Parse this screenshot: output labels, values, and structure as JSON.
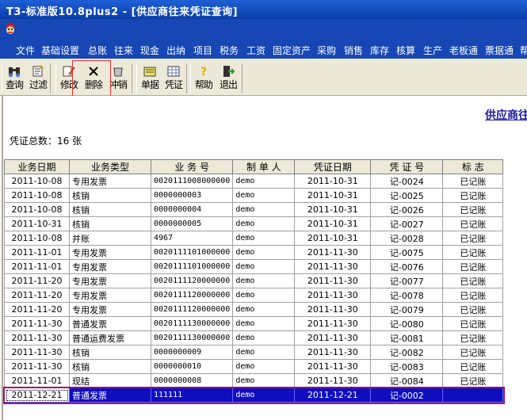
{
  "window": {
    "title": "T3-标准版10.8plus2 - [供应商往来凭证查询]"
  },
  "menu": [
    "文件",
    "基础设置",
    "总账",
    "往来",
    "现金",
    "出纳",
    "项目",
    "税务",
    "工资",
    "固定资产",
    "采购",
    "销售",
    "库存",
    "核算",
    "生产",
    "老板通",
    "票据通",
    "帮"
  ],
  "toolbar": {
    "buttons": [
      {
        "label": "查询",
        "icon": "binoculars-icon"
      },
      {
        "label": "过滤",
        "icon": "filter-icon"
      },
      {
        "label": "修改",
        "icon": "edit-icon"
      },
      {
        "label": "删除",
        "icon": "delete-icon"
      },
      {
        "label": "冲销",
        "icon": "reverse-icon"
      },
      {
        "label": "单据",
        "icon": "document-icon"
      },
      {
        "label": "凭证",
        "icon": "voucher-icon"
      },
      {
        "label": "帮助",
        "icon": "help-icon"
      },
      {
        "label": "退出",
        "icon": "exit-icon"
      }
    ]
  },
  "report": {
    "title": "供应商往",
    "count_label": "凭证总数：16 张"
  },
  "table": {
    "columns": [
      "业务日期",
      "业务类型",
      "业 务 号",
      "制 单 人",
      "凭证日期",
      "凭 证 号",
      "标    志"
    ],
    "rows": [
      [
        "2011-10-08",
        "专用发票",
        "0020111008000000",
        "demo",
        "2011-10-31",
        "记-0024",
        "已记账"
      ],
      [
        "2011-10-08",
        "核销",
        "0000000003",
        "demo",
        "2011-10-31",
        "记-0025",
        "已记账"
      ],
      [
        "2011-10-08",
        "核销",
        "0000000004",
        "demo",
        "2011-10-31",
        "记-0026",
        "已记账"
      ],
      [
        "2011-10-31",
        "核销",
        "0000000005",
        "demo",
        "2011-10-31",
        "记-0027",
        "已记账"
      ],
      [
        "2011-10-08",
        "并账",
        "4967",
        "demo",
        "2011-10-31",
        "记-0028",
        "已记账"
      ],
      [
        "2011-11-01",
        "专用发票",
        "0020111101000000",
        "demo",
        "2011-11-30",
        "记-0075",
        "已记账"
      ],
      [
        "2011-11-01",
        "专用发票",
        "0020111101000000",
        "demo",
        "2011-11-30",
        "记-0076",
        "已记账"
      ],
      [
        "2011-11-20",
        "专用发票",
        "0020111120000000",
        "demo",
        "2011-11-30",
        "记-0077",
        "已记账"
      ],
      [
        "2011-11-20",
        "专用发票",
        "0020111120000000",
        "demo",
        "2011-11-30",
        "记-0078",
        "已记账"
      ],
      [
        "2011-11-20",
        "专用发票",
        "0020111120000000",
        "demo",
        "2011-11-30",
        "记-0079",
        "已记账"
      ],
      [
        "2011-11-30",
        "普通发票",
        "0020111130000000",
        "demo",
        "2011-11-30",
        "记-0080",
        "已记账"
      ],
      [
        "2011-11-30",
        "普通运费发票",
        "0020111130000000",
        "demo",
        "2011-11-30",
        "记-0081",
        "已记账"
      ],
      [
        "2011-11-30",
        "核销",
        "0000000009",
        "demo",
        "2011-11-30",
        "记-0082",
        "已记账"
      ],
      [
        "2011-11-30",
        "核销",
        "0000000010",
        "demo",
        "2011-11-30",
        "记-0083",
        "已记账"
      ],
      [
        "2011-11-01",
        "现结",
        "0000000008",
        "demo",
        "2011-11-30",
        "记-0084",
        "已记账"
      ],
      [
        "2011-12-21",
        "普通发票",
        "111111",
        "demo",
        "2011-12-21",
        "记-0002",
        ""
      ]
    ],
    "selected_row": 15
  },
  "colors": {
    "title_bar": "#0a3ea8",
    "menu_bar": "#1647b4",
    "selection": "#0f0fc0",
    "annotation": "#e03030"
  }
}
